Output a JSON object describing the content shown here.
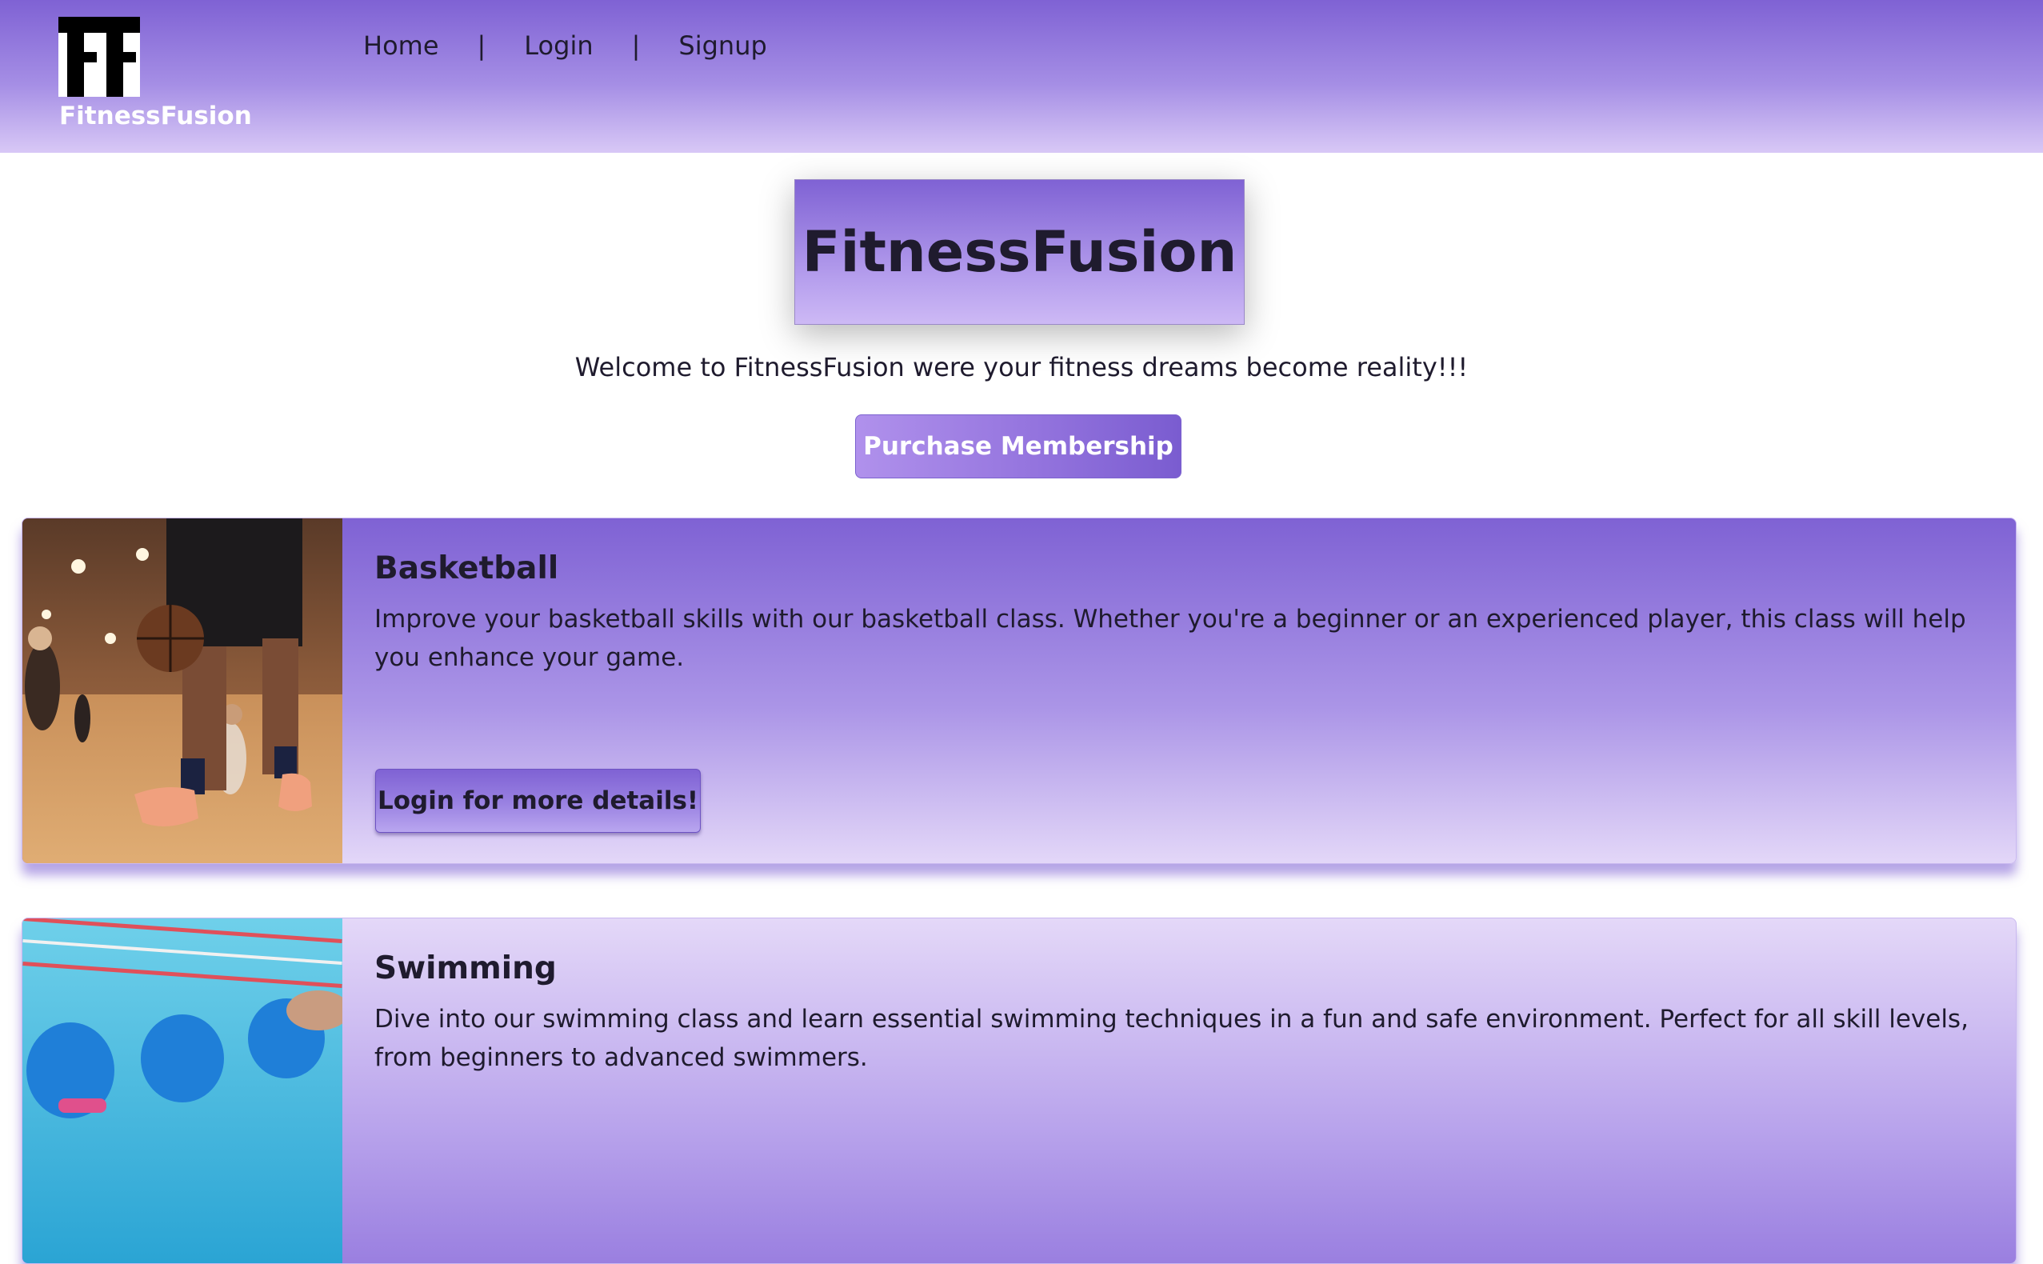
{
  "header": {
    "logo_icon": "ff-monogram-icon",
    "brand_name": "FitnessFusion",
    "nav": {
      "home": "Home",
      "separator": "|",
      "login": "Login",
      "signup": "Signup"
    }
  },
  "hero": {
    "title": "FitnessFusion",
    "subtitle": "Welcome to FitnessFusion were your fitness dreams become reality!!!",
    "purchase_label": "Purchase Membership"
  },
  "classes": [
    {
      "title": "Basketball",
      "description": "Improve your basketball skills with our basketball class. Whether you're a beginner or an experienced player, this class will help you enhance your game.",
      "button_label": "Login for more details!",
      "image": "basketball-photo"
    },
    {
      "title": "Swimming",
      "description": "Dive into our swimming class and learn essential swimming techniques in a fun and safe environment. Perfect for all skill levels, from beginners to advanced swimmers.",
      "image": "swimming-photo"
    }
  ],
  "colors": {
    "accent_purple": "#7f62d4",
    "light_purple": "#d8c8f6",
    "text_dark": "#1f1b2e"
  }
}
